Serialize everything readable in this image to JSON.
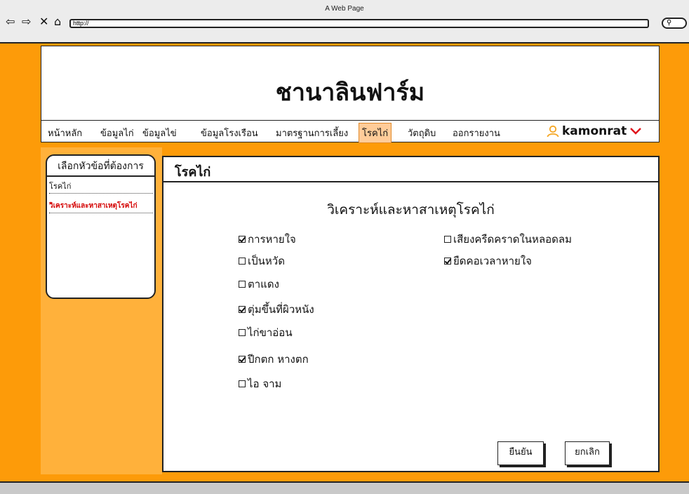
{
  "window": {
    "title": "A Web Page",
    "url": "http://"
  },
  "site": {
    "title": "ชานาลินฟาร์ม"
  },
  "nav": {
    "items": [
      {
        "label": "หน้าหลัก"
      },
      {
        "label": "ข้อมูลไก่"
      },
      {
        "label": "ข้อมูลไข่"
      },
      {
        "label": "ข้อมูลโรงเรือน"
      },
      {
        "label": "มาตรฐานการเลี้ยง"
      },
      {
        "label": "โรคไก่",
        "active": true
      },
      {
        "label": "วัตถุดิบ"
      },
      {
        "label": "ออกรายงาน"
      }
    ],
    "user": "kamonrat"
  },
  "sidebar": {
    "heading": "เลือกหัวข้อที่ต้องการ",
    "items": [
      {
        "label": "โรคไก่"
      },
      {
        "label": "วิเคราะห์และหาสาเหตุโรคไก่",
        "active": true
      }
    ]
  },
  "main": {
    "title": "โรคไก่",
    "section_title": "วิเคราะห์และหาสาเหตุโรคไก่",
    "options_left": [
      {
        "label": "การหายใจ",
        "checked": true
      },
      {
        "label": "เป็นหวัด",
        "checked": false
      },
      {
        "label": "ตาแดง",
        "checked": false
      },
      {
        "label": "ตุ่มขึ้นที่ผิวหนัง",
        "checked": true
      },
      {
        "label": "ไก่ขาอ่อน",
        "checked": false
      },
      {
        "label": "ปีกตก หางตก",
        "checked": true
      },
      {
        "label": "ไอ จาม",
        "checked": false
      }
    ],
    "options_right": [
      {
        "label": "เสียงครืดคราดในหลอดลม",
        "checked": false
      },
      {
        "label": "ยืดคอเวลาหายใจ",
        "checked": true
      }
    ],
    "confirm_label": "ยืนยัน",
    "cancel_label": "ยกเลิก"
  },
  "colors": {
    "canvas": "#fd9b09",
    "sidebar_panel": "#ffb13b",
    "active_tab": "#ffcc99",
    "active_link": "#d40000",
    "user_icon": "#f5a623",
    "chevron": "#e0141c"
  }
}
